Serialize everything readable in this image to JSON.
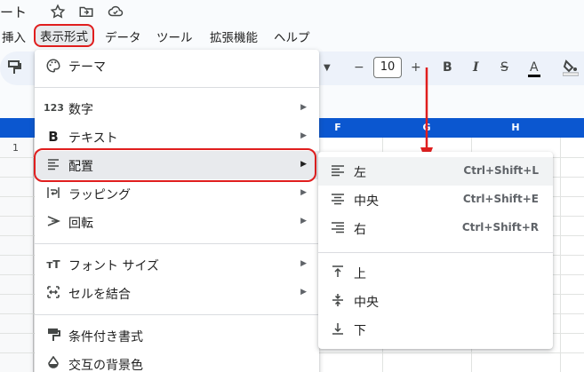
{
  "title": {
    "doc_name_fragment": "ート"
  },
  "menubar": {
    "items": [
      "挿入",
      "表示形式",
      "データ",
      "ツール",
      "拡張機能",
      "ヘルプ"
    ],
    "active": "表示形式"
  },
  "toolbar": {
    "font_size": "10",
    "minus": "−",
    "plus": "+",
    "bold": "B",
    "italic": "I",
    "strike": "S",
    "textcolor": "A"
  },
  "grid": {
    "col_headers": [
      "F",
      "G",
      "H"
    ],
    "row_numbers": [
      "1"
    ],
    "header_color": "#0b57d0"
  },
  "format_menu": {
    "items": [
      {
        "icon": "palette-icon",
        "label": "テーマ",
        "has_submenu": false
      },
      {
        "icon": "number-123-icon",
        "label": "数字",
        "has_submenu": true
      },
      {
        "icon": "bold-icon",
        "label": "テキスト",
        "has_submenu": true
      },
      {
        "icon": "align-left-icon",
        "label": "配置",
        "has_submenu": true,
        "selected": true
      },
      {
        "icon": "wrap-icon",
        "label": "ラッピング",
        "has_submenu": true
      },
      {
        "icon": "rotate-icon",
        "label": "回転",
        "has_submenu": true
      },
      {
        "icon": "font-size-icon",
        "label": "フォント サイズ",
        "has_submenu": true
      },
      {
        "icon": "merge-cells-icon",
        "label": "セルを結合",
        "has_submenu": true
      },
      {
        "icon": "paint-roller-icon",
        "label": "条件付き書式",
        "has_submenu": false
      },
      {
        "icon": "alternating-colors-icon",
        "label": "交互の背景色",
        "has_submenu": false
      }
    ]
  },
  "align_submenu": {
    "items": [
      {
        "icon": "align-left-icon",
        "label": "左",
        "shortcut": "Ctrl+Shift+L"
      },
      {
        "icon": "align-center-icon",
        "label": "中央",
        "shortcut": "Ctrl+Shift+E"
      },
      {
        "icon": "align-right-icon",
        "label": "右",
        "shortcut": "Ctrl+Shift+R"
      },
      {
        "icon": "align-top-icon",
        "label": "上",
        "shortcut": ""
      },
      {
        "icon": "align-middle-icon",
        "label": "中央",
        "shortcut": ""
      },
      {
        "icon": "align-bottom-icon",
        "label": "下",
        "shortcut": ""
      }
    ]
  },
  "colors": {
    "annotation_red": "#e01e1e",
    "accent_blue": "#0b57d0"
  }
}
